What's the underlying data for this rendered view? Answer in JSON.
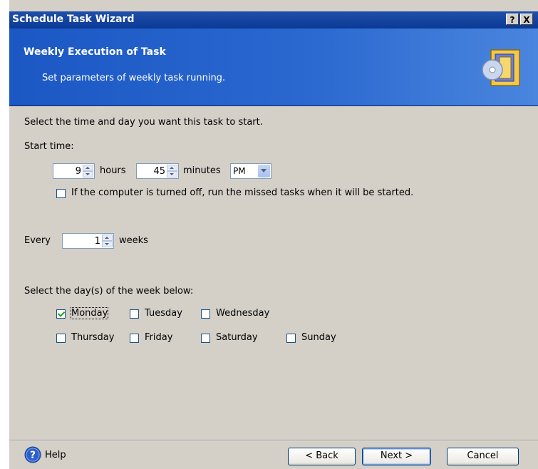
{
  "window": {
    "title": "Schedule Task Wizard",
    "help_btn": "?",
    "close_btn": "X"
  },
  "header": {
    "title": "Weekly Execution of Task",
    "subtitle": "Set parameters of weekly task running."
  },
  "form": {
    "instruction": "Select the time and day you want this task to start.",
    "start_time_label": "Start time:",
    "hours_value": "9",
    "hours_label": "hours",
    "minutes_value": "45",
    "minutes_label": "minutes",
    "ampm_value": "PM",
    "missed_tasks_label": "If the computer is turned off, run the missed tasks when it will be started.",
    "missed_tasks_checked": false,
    "every_label": "Every",
    "every_value": "1",
    "weeks_label": "weeks",
    "days_instruction": "Select the day(s) of the week below:",
    "days": [
      {
        "label": "Monday",
        "checked": true
      },
      {
        "label": "Tuesday",
        "checked": false
      },
      {
        "label": "Wednesday",
        "checked": false
      },
      {
        "label": "Thursday",
        "checked": false
      },
      {
        "label": "Friday",
        "checked": false
      },
      {
        "label": "Saturday",
        "checked": false
      },
      {
        "label": "Sunday",
        "checked": false
      }
    ]
  },
  "footer": {
    "help_label": "Help",
    "back_label": "< Back",
    "next_label": "Next >",
    "cancel_label": "Cancel"
  },
  "colors": {
    "header_blue": "#2a67cf",
    "titlebar_blue": "#0a3a95",
    "dialog_bg": "#d4d0c8"
  }
}
